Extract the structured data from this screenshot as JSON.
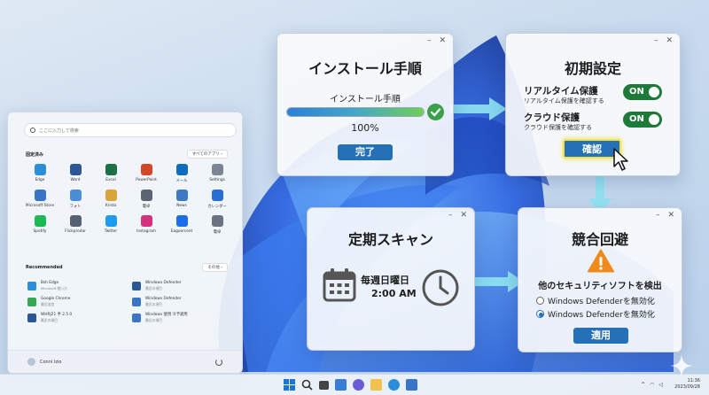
{
  "start_menu": {
    "search_placeholder": "ここに入力して検索",
    "pinned_title": "固定済み",
    "all_apps_label": "すべてのアプリ ›",
    "pinned_apps": [
      {
        "label": "Edge",
        "color": "#2a8fd8"
      },
      {
        "label": "Word",
        "color": "#2b5797"
      },
      {
        "label": "Excel",
        "color": "#1e7145"
      },
      {
        "label": "PowerPoint",
        "color": "#d24726"
      },
      {
        "label": "メール",
        "color": "#0f6cbd"
      },
      {
        "label": "Settings",
        "color": "#7c8594"
      },
      {
        "label": "Microsoft Store",
        "color": "#3a74c4"
      },
      {
        "label": "フォト",
        "color": "#4a8fd6"
      },
      {
        "label": "Krista",
        "color": "#d9a53a"
      },
      {
        "label": "電卓",
        "color": "#5b6572"
      },
      {
        "label": "News",
        "color": "#3f79c1"
      },
      {
        "label": "カレンダー",
        "color": "#2a6ed1"
      },
      {
        "label": "Spotify",
        "color": "#1db954"
      },
      {
        "label": "Flickprodar",
        "color": "#566173"
      },
      {
        "label": "Twitter",
        "color": "#1d9bf0"
      },
      {
        "label": "Instagram",
        "color": "#d6317d"
      },
      {
        "label": "Eagoorcent",
        "color": "#1c6ee8"
      },
      {
        "label": "電卓",
        "color": "#6a737e"
      }
    ],
    "recommended_title": "Recommended",
    "more_label": "その他 ›",
    "recommended": [
      {
        "title": "Bsh Edge",
        "sub": "Microsoft 使い方",
        "color": "#2a8fd8"
      },
      {
        "title": "Windows Defender",
        "sub": "最近の項目",
        "color": "#2b5797"
      },
      {
        "title": "Google Chrome",
        "sub": "最近追加",
        "color": "#34a853"
      },
      {
        "title": "Windows Defender",
        "sub": "最近の項目",
        "color": "#3a74c4"
      },
      {
        "title": "WHRJ21 手 2.5 0",
        "sub": "最近の項目",
        "color": "#2b5797"
      },
      {
        "title": "Windows 使用 冷予避用",
        "sub": "最近の項目",
        "color": "#3a74c4"
      }
    ],
    "user_name": "Conni Izio"
  },
  "install_card": {
    "title": "インストール手順",
    "progress_label": "インストール手順",
    "progress_fraction": 1.0,
    "percent_text": "100%",
    "button_label": "完了"
  },
  "initial_card": {
    "title": "初期設定",
    "realtime_title": "リアルタイム保護",
    "realtime_sub": "リアルタイム保護を確認する",
    "realtime_toggle": "ON",
    "cloud_title": "クラウド保護",
    "cloud_sub": "クラウド保護を確認する",
    "cloud_toggle": "ON",
    "button_label": "確認"
  },
  "scan_card": {
    "title": "定期スキャン",
    "schedule_day": "毎週日曜日",
    "schedule_time": "2:00 AM"
  },
  "conflict_card": {
    "title": "競合回避",
    "heading": "他のセキュリティソフトを検出",
    "option_1": "Windows Defenderを無効化",
    "option_2": "Windows Defenderを無効化",
    "selected_option": 2,
    "button_label": "適用"
  },
  "window_controls": {
    "minimize": "–",
    "close": "✕"
  },
  "taskbar": {
    "time": "11:36",
    "date": "2023/09/28"
  },
  "colors": {
    "accent_blue": "#2471b8",
    "toggle_green": "#1e7a39",
    "progress_green": "#5cc04a",
    "arrow_cyan": "#8fe3f2",
    "warning_orange": "#f08a1c"
  }
}
